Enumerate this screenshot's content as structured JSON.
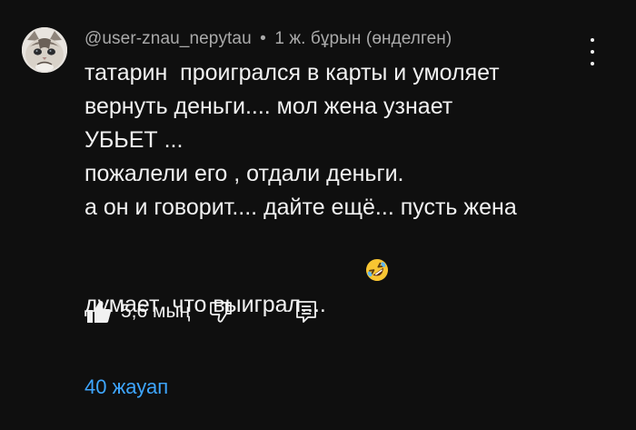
{
  "comment": {
    "author": "@user-znau_nepytau",
    "separator": "•",
    "time": "1 ж. бұрын (өнделген)",
    "text_lines": [
      "татарин  проигрался в карты и умоляет",
      "вернуть деньги.... мол жена узнает",
      "УБЬЕТ ...",
      "пожалели его , отдали деньги.",
      "а он и говорит.... дайте ещё... пусть жена",
      "думает  что выиграл...."
    ],
    "emoji": "rolling-on-floor-laughing-emoji",
    "avatar": "grumpy-cat-avatar"
  },
  "actions": {
    "like_icon": "thumbs-up-icon",
    "like_count": "5,6 мың",
    "dislike_icon": "thumbs-down-icon",
    "reply_icon": "reply-icon"
  },
  "replies": {
    "label": "40 жауап",
    "color": "#3ea6ff"
  },
  "menu_icon": "more-vertical-icon",
  "colors": {
    "background": "#0f0f0f",
    "text": "#f1f1f1",
    "secondary_text": "#aaaaaa"
  }
}
